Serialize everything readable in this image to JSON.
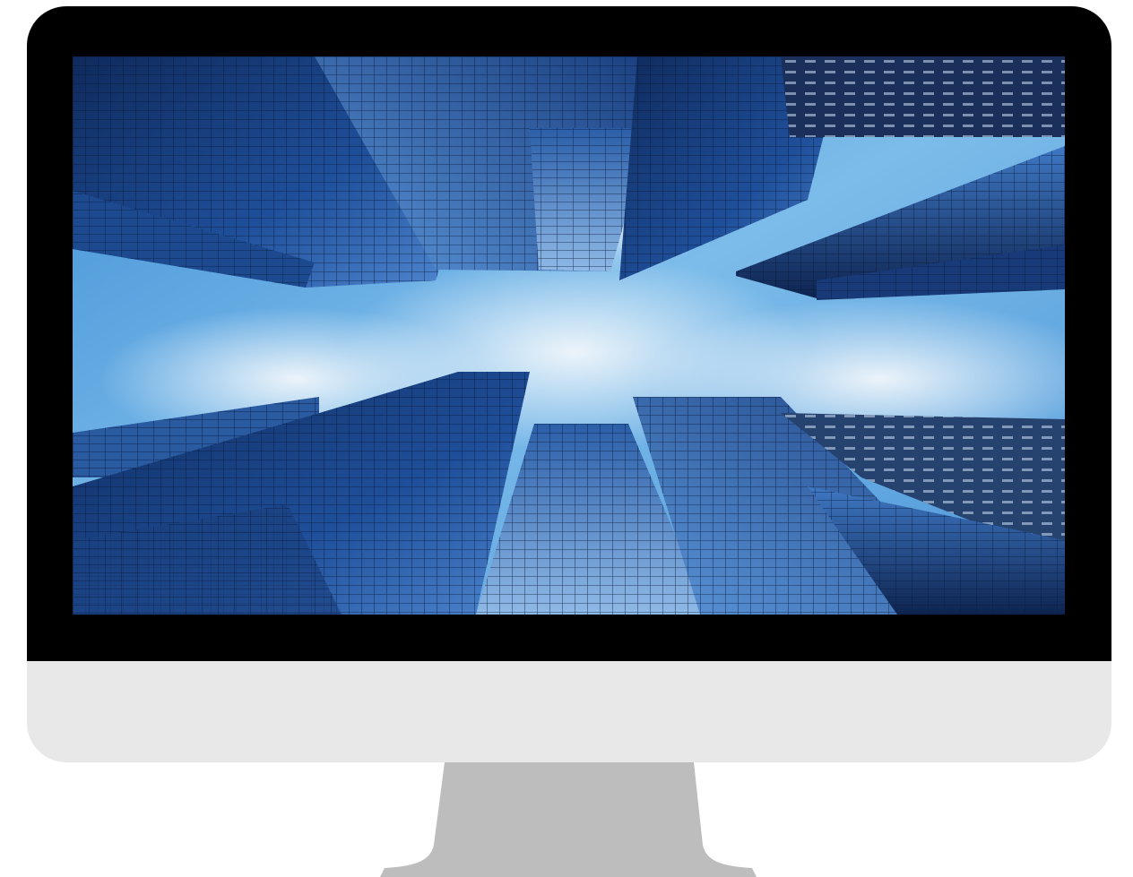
{
  "device": {
    "type": "desktop monitor",
    "bezel_color": "#000000",
    "chin_color": "#e8e8e8",
    "stand_color": "#bdbdbd"
  },
  "screen": {
    "content": "skyscraper-low-angle-photo",
    "sky_color": "#5aa6e0",
    "cloud_color": "#e6f0f8",
    "glass_dark": "#0f2a5c",
    "glass_mid": "#1f4f9a",
    "glass_light": "#4f86cf"
  }
}
